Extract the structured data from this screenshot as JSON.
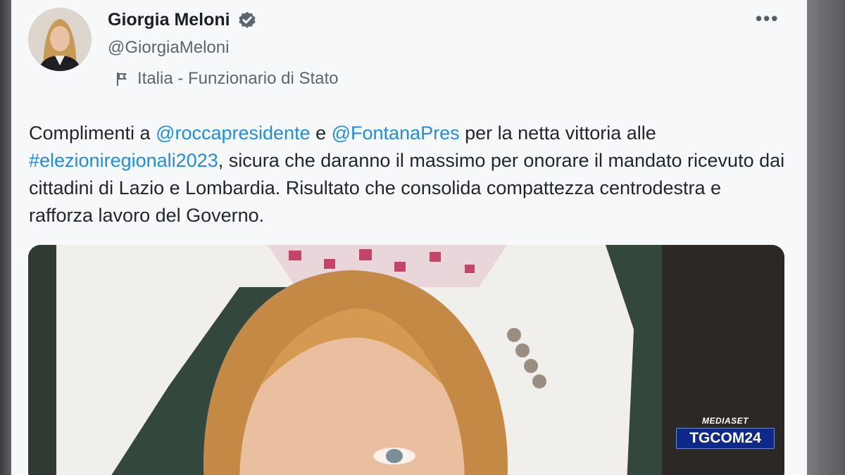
{
  "post": {
    "author_name": "Giorgia Meloni",
    "author_handle": "@GiorgiaMeloni",
    "affiliation": "Italia - Funzionario di Stato",
    "more_icon": "•••",
    "text": {
      "t1": "Complimenti a ",
      "mention1": "@roccapresidente",
      "t2": " e ",
      "mention2": "@FontanaPres",
      "t3": " per la netta vittoria alle ",
      "hashtag": "#elezioniregionali2023",
      "t4": ", sicura che daranno il massimo per onorare il mandato ricevuto dai cittadini di Lazio e Lombardia. Risultato che consolida compattezza centrodestra e rafforza lavoro del Governo."
    }
  },
  "watermark": {
    "network": "MEDIASET",
    "logo": "TGCOM24"
  },
  "colors": {
    "link": "#1f8ee0",
    "verified_badge": "#5b6670",
    "card_bg": "#f7f8f9"
  }
}
